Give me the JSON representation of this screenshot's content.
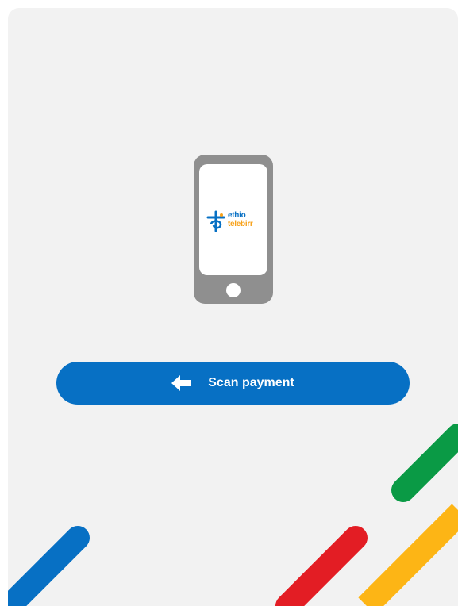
{
  "brand": {
    "logo_line1": "ethio",
    "logo_line2": "telebirr",
    "primary_color": "#0770c4",
    "accent_orange": "#f7a21b"
  },
  "scan_button": {
    "label": "Scan payment",
    "icon": "arrow-left-icon"
  },
  "decor_colors": {
    "blue": "#0770c4",
    "green": "#0a9a45",
    "red": "#e31d24",
    "yellow": "#fdb515"
  }
}
